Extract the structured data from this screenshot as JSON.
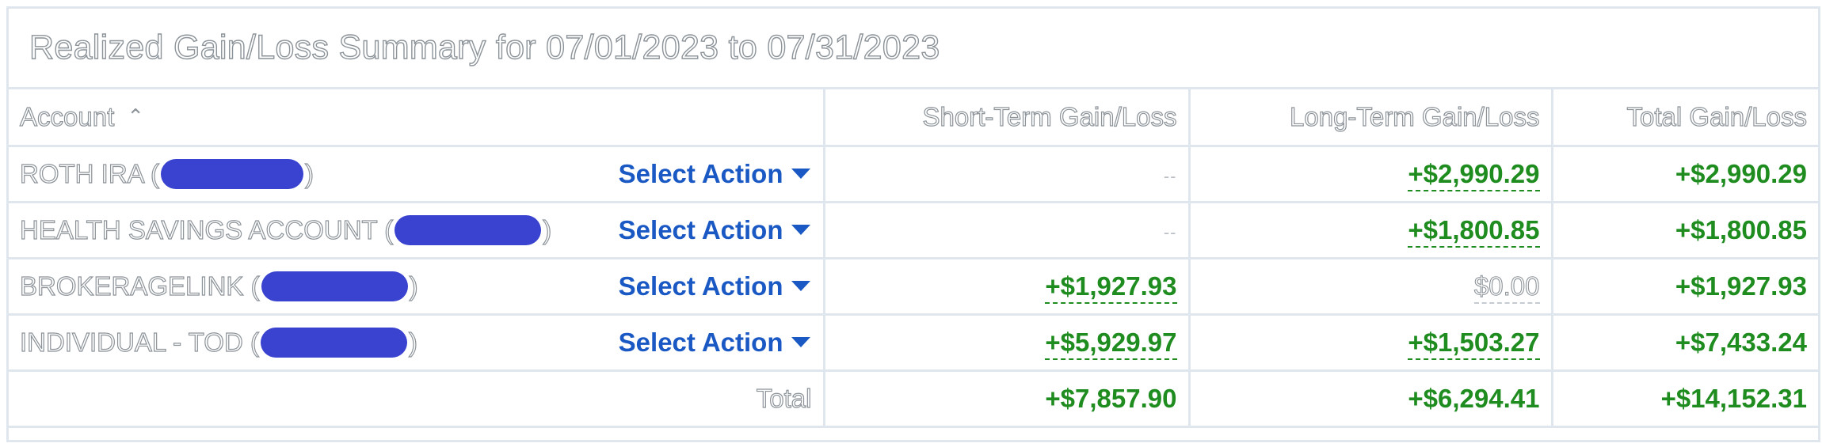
{
  "title": "Realized Gain/Loss Summary for 07/01/2023 to 07/31/2023",
  "columns": {
    "account": "Account",
    "short_term": "Short-Term Gain/Loss",
    "long_term": "Long-Term Gain/Loss",
    "total": "Total Gain/Loss"
  },
  "sort_icon": "chevron-up-icon",
  "rows": [
    {
      "name_prefix": "ROTH IRA (",
      "name_suffix": ")",
      "action": "Select Action",
      "short_term": "--",
      "long_term": "+$2,990.29",
      "total": "+$2,990.29"
    },
    {
      "name_prefix": "HEALTH SAVINGS ACCOUNT (",
      "name_suffix": ")",
      "action": "Select Action",
      "short_term": "--",
      "long_term": "+$1,800.85",
      "total": "+$1,800.85"
    },
    {
      "name_prefix": "BROKERAGELINK (",
      "name_suffix": ")",
      "action": "Select Action",
      "short_term": "+$1,927.93",
      "long_term": "$0.00",
      "total": "+$1,927.93"
    },
    {
      "name_prefix": "INDIVIDUAL - TOD (",
      "name_suffix": ")",
      "action": "Select Action",
      "short_term": "+$5,929.97",
      "long_term": "+$1,503.27",
      "total": "+$7,433.24"
    }
  ],
  "totals": {
    "label": "Total",
    "short_term": "+$7,857.90",
    "long_term": "+$6,294.41",
    "total": "+$14,152.31"
  },
  "colors": {
    "gain": "#1f8c1f",
    "link": "#1a58c4",
    "redaction": "#3a43cf",
    "border": "#dfe6ee"
  }
}
